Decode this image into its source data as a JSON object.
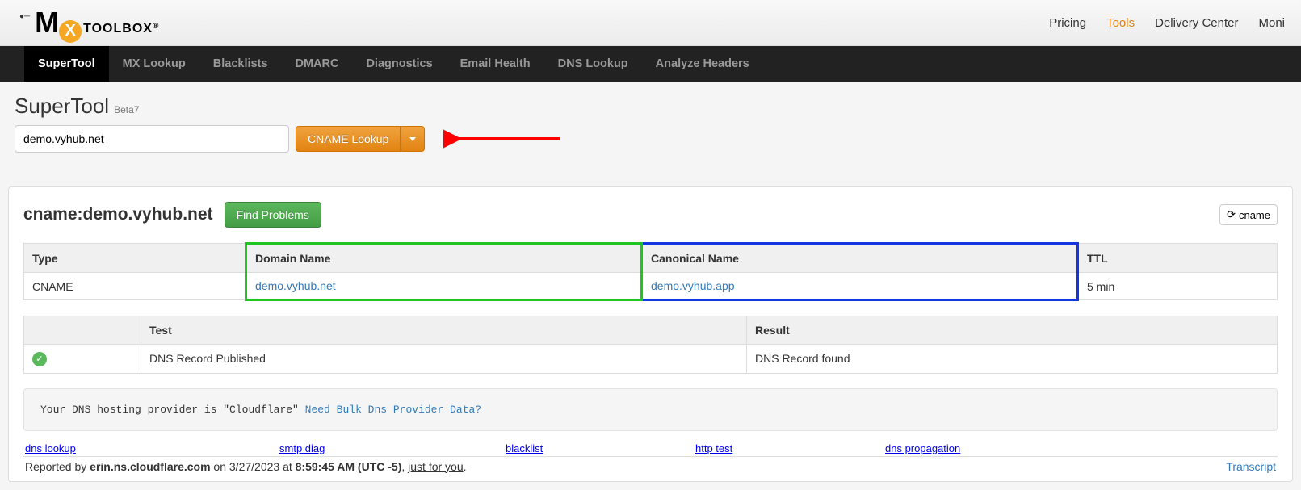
{
  "topnav": {
    "items": [
      "Pricing",
      "Tools",
      "Delivery Center",
      "Moni"
    ],
    "active_index": 1
  },
  "logo": {
    "m": "M",
    "x": "X",
    "toolbox": "TOOLBOX",
    "reg": "®"
  },
  "toolnav": {
    "items": [
      "SuperTool",
      "MX Lookup",
      "Blacklists",
      "DMARC",
      "Diagnostics",
      "Email Health",
      "DNS Lookup",
      "Analyze Headers"
    ],
    "active_index": 0
  },
  "page": {
    "title": "SuperTool",
    "beta": "Beta7"
  },
  "search": {
    "value": "demo.vyhub.net",
    "button_label": "CNAME Lookup"
  },
  "result": {
    "title": "cname:demo.vyhub.net",
    "find_problems_label": "Find Problems",
    "refresh_label": "cname"
  },
  "table1": {
    "headers": {
      "type": "Type",
      "domain": "Domain Name",
      "canonical": "Canonical Name",
      "ttl": "TTL"
    },
    "row": {
      "type": "CNAME",
      "domain": "demo.vyhub.net",
      "canonical": "demo.vyhub.app",
      "ttl": "5 min"
    }
  },
  "table2": {
    "headers": {
      "test": "Test",
      "result": "Result"
    },
    "row": {
      "test": "DNS Record Published",
      "result": "DNS Record found"
    }
  },
  "info": {
    "text": "Your DNS hosting provider is \"Cloudflare\"  ",
    "link": "Need Bulk Dns Provider Data?"
  },
  "retest": {
    "items": [
      "dns lookup",
      "smtp diag",
      "blacklist",
      "http test",
      "dns propagation"
    ]
  },
  "reported": {
    "prefix": "Reported by ",
    "server": "erin.ns.cloudflare.com",
    "on": " on 3/27/2023 at ",
    "time": "8:59:45 AM (UTC -5)",
    "comma": ", ",
    "justforyou": "just for you",
    "period": ".",
    "transcript": "Transcript"
  }
}
